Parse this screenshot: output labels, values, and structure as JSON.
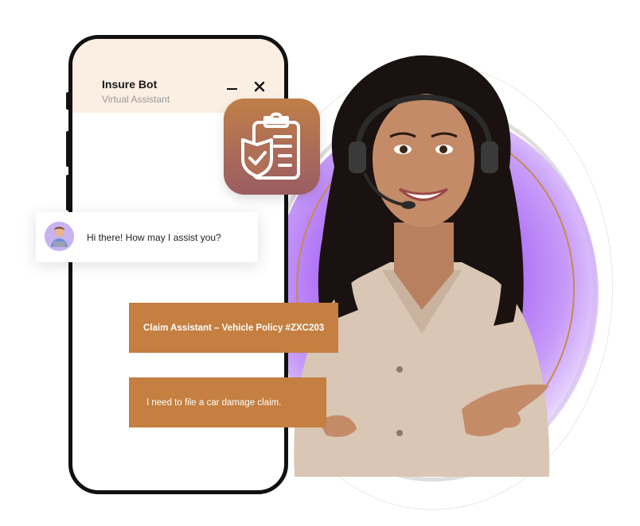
{
  "chat_window": {
    "bot_name": "Insure Bot",
    "bot_subtitle": "Virtual Assistant",
    "minimize_label": "minimize",
    "close_label": "close"
  },
  "messages": {
    "greeting": "Hi there! How may I assist you?",
    "claim_header": "Claim Assistant – Vehicle Policy #ZXC203",
    "user_message": "I need to file a car damage claim."
  },
  "icons": {
    "app_icon": "clipboard-shield-check-icon",
    "avatar": "bot-avatar",
    "minimize": "minus-icon",
    "close": "close-icon"
  },
  "colors": {
    "accent_brown": "#c47f41",
    "header_bg": "#fbeee3",
    "glow_purple": "#9a4df0",
    "ring_orange": "#c58a52"
  }
}
